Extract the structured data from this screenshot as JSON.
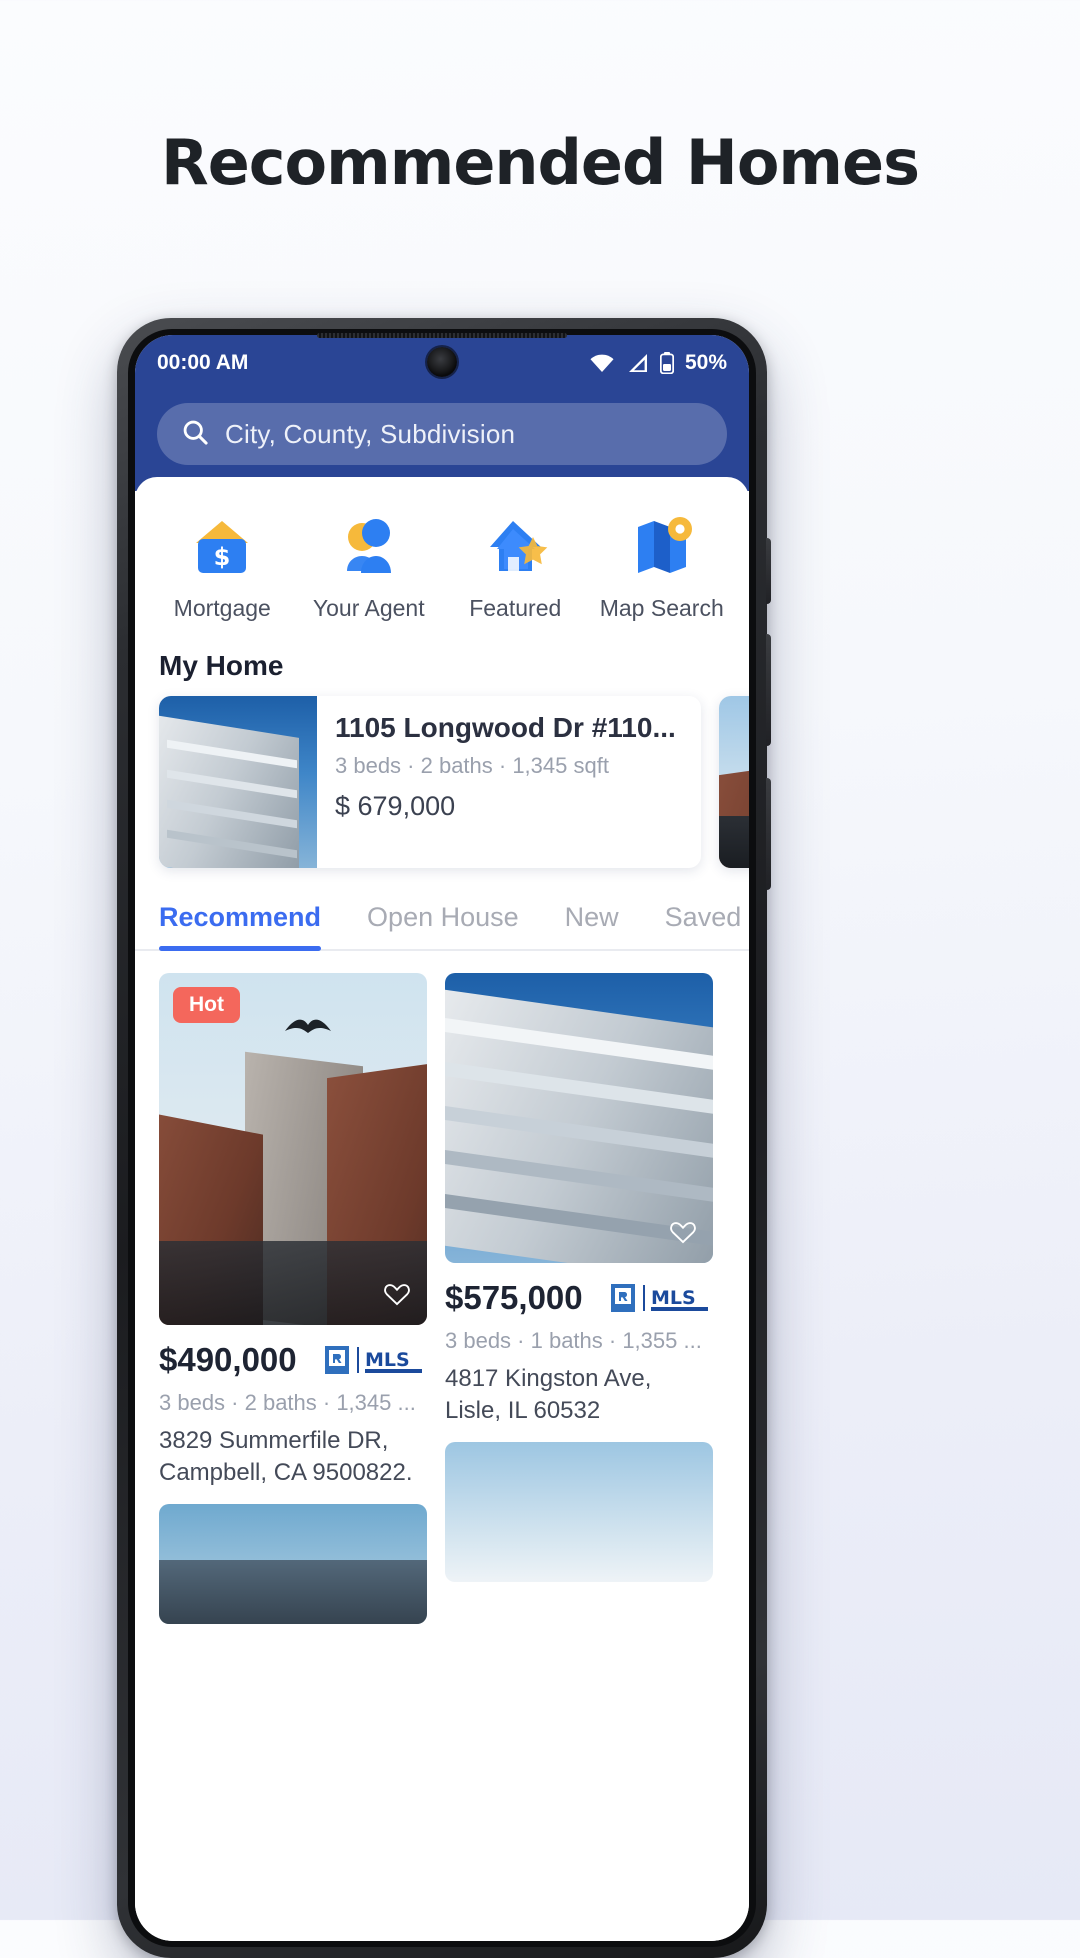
{
  "page": {
    "title": "Recommended Homes"
  },
  "status_bar": {
    "time": "00:00 AM",
    "battery": "50%",
    "wifi_icon": "wifi-icon",
    "signal_icon": "cell-signal-icon",
    "battery_icon": "battery-icon"
  },
  "search": {
    "placeholder": "City, County, Subdivision",
    "icon": "search-icon"
  },
  "quick_actions": [
    {
      "label": "Mortgage",
      "icon": "mortgage-wallet-icon"
    },
    {
      "label": "Your Agent",
      "icon": "agent-people-icon"
    },
    {
      "label": "Featured",
      "icon": "featured-house-star-icon"
    },
    {
      "label": "Map Search",
      "icon": "map-pin-icon"
    }
  ],
  "my_home": {
    "title": "My Home",
    "cards": [
      {
        "address": "1105 Longwood Dr #110...",
        "meta": "3 beds · 2 baths · 1,345 sqft",
        "price": "$ 679,000"
      }
    ]
  },
  "tabs": [
    {
      "label": "Recommend",
      "active": true
    },
    {
      "label": "Open House",
      "active": false
    },
    {
      "label": "New",
      "active": false
    },
    {
      "label": "Saved",
      "active": false
    }
  ],
  "listings": {
    "left": [
      {
        "badge": "Hot",
        "price": "$490,000",
        "beds": "3",
        "beds_label": " beds",
        "baths": "2",
        "baths_label": " baths",
        "sqft": "1,345 ...",
        "meta": "3 beds · 2 baths · 1,345 ...",
        "address": "3829 Summerfile DR, Campbell, CA 9500822.",
        "mls_logo": "realtor-mls-logo",
        "favorite_icon": "heart-icon"
      }
    ],
    "right": [
      {
        "price": "$575,000",
        "meta": "3 beds · 1 baths · 1,355 ...",
        "address": "4817 Kingston Ave, Lisle, IL 60532",
        "mls_logo": "realtor-mls-logo",
        "favorite_icon": "heart-icon"
      }
    ]
  },
  "colors": {
    "brand_blue": "#2a4595",
    "accent_blue": "#3b6cf0",
    "hot_badge": "#f4675c",
    "mls_blue": "#1b4a9c"
  }
}
